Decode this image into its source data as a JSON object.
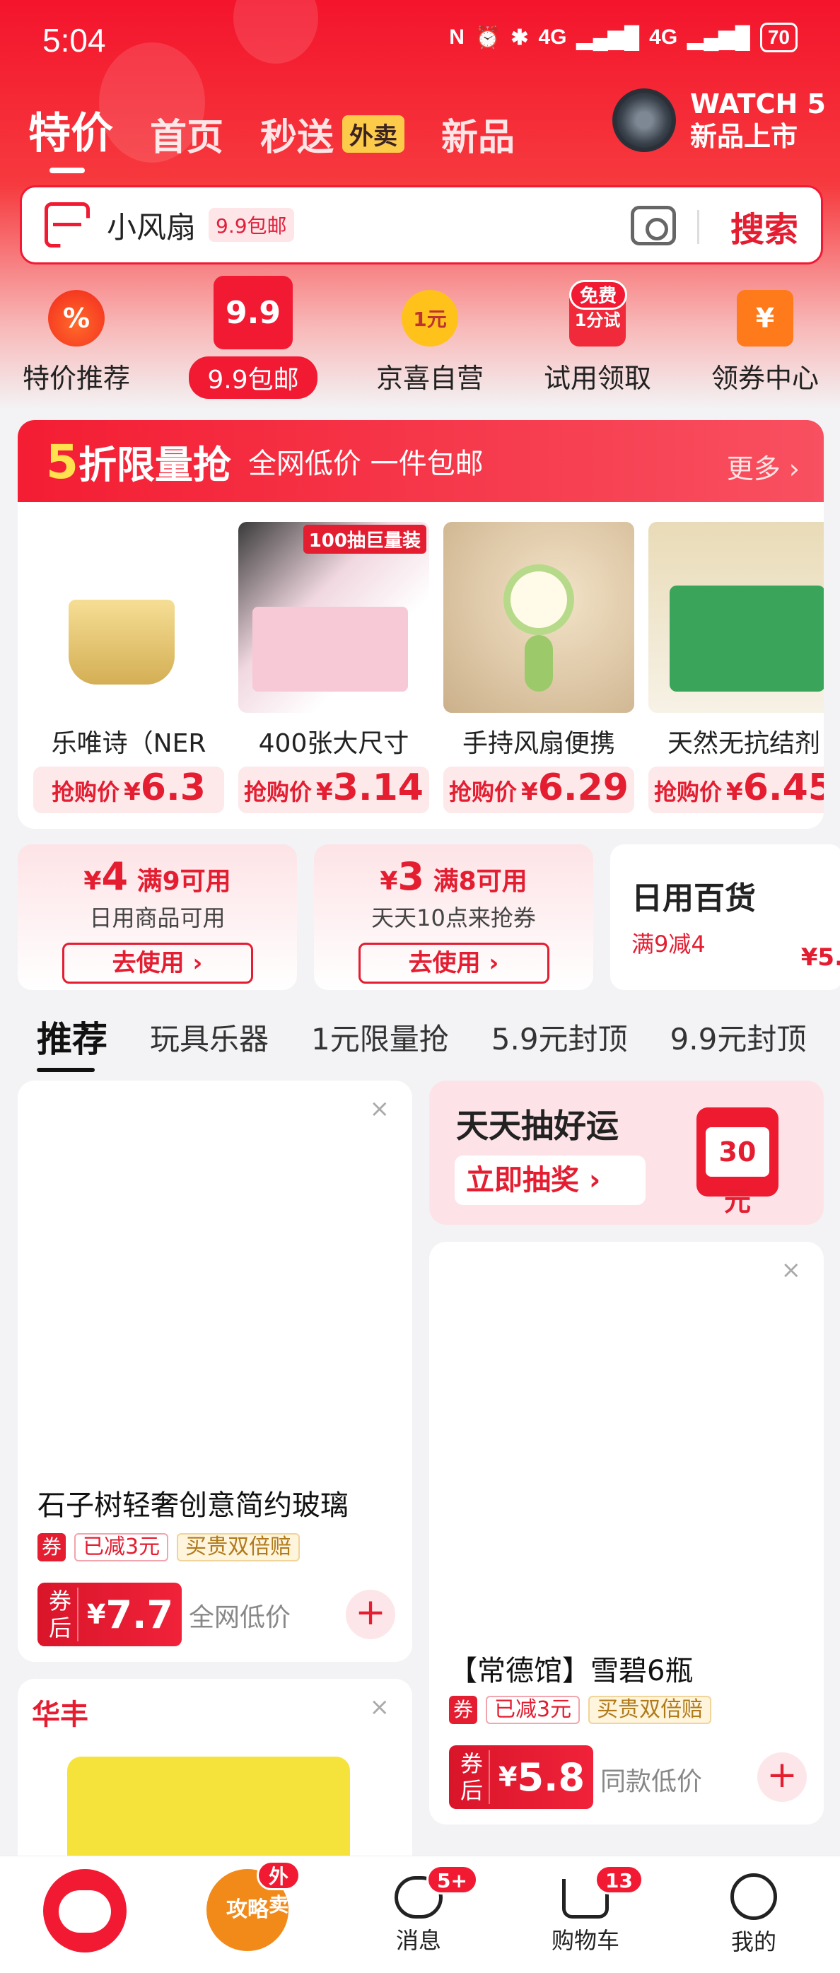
{
  "status_bar": {
    "time": "5:04",
    "network1": "4G",
    "network2": "4G",
    "battery": "70"
  },
  "top_nav": {
    "tabs": [
      {
        "label": "特价",
        "active": true
      },
      {
        "label": "首页"
      },
      {
        "label": "秒送",
        "badge": "外卖"
      },
      {
        "label": "新品"
      }
    ],
    "promo": {
      "line1": "WATCH 5",
      "line2": "新品上市"
    }
  },
  "search": {
    "query": "小风扇",
    "tag": "9.9包邮",
    "button": "搜索"
  },
  "quick_links": [
    {
      "label": "特价推荐",
      "icon": "fire-percent-icon"
    },
    {
      "label": "9.9包邮",
      "icon": "gift-box-icon",
      "icon_text": "9.9"
    },
    {
      "label": "京喜自营",
      "icon": "one-yuan-badge-icon",
      "icon_text": "1元"
    },
    {
      "label": "试用领取",
      "icon": "trial-icon",
      "icon_text": "1分试",
      "badge": "免费"
    },
    {
      "label": "领券中心",
      "icon": "coupon-icon",
      "icon_text": "¥"
    }
  ],
  "flash_sale": {
    "title_num": "5",
    "title": "折限量抢",
    "subtitle": "全网低价 一件包邮",
    "more": "更多 ›",
    "price_label": "抢购价",
    "currency": "¥",
    "products": [
      {
        "name": "乐唯诗（NER",
        "price": "6.3"
      },
      {
        "name": "400张大尺寸",
        "price": "3.14",
        "badge": "100抽巨量装"
      },
      {
        "name": "手持风扇便携",
        "price": "6.29"
      },
      {
        "name": "天然无抗结剂",
        "price": "6.45"
      }
    ]
  },
  "coupons": [
    {
      "currency": "¥",
      "amount": "4",
      "condition": "满9可用",
      "desc": "日用商品可用",
      "button": "去使用 ›"
    },
    {
      "currency": "¥",
      "amount": "3",
      "condition": "满8可用",
      "desc": "天天10点来抢券",
      "button": "去使用 ›"
    },
    {
      "title": "日用百货",
      "sub": "满9减4",
      "price": "¥5."
    }
  ],
  "category_tabs": [
    {
      "label": "推荐",
      "active": true
    },
    {
      "label": "玩具乐器"
    },
    {
      "label": "1元限量抢"
    },
    {
      "label": "5.9元封顶"
    },
    {
      "label": "9.9元封顶"
    }
  ],
  "feed": {
    "left": [
      {
        "title": "石子树轻奢创意简约玻璃",
        "coupon_tag": "券",
        "discount": "已减3元",
        "guarantee": "买贵双倍赔",
        "price_label": "券后",
        "currency": "¥",
        "price": "7.7",
        "note": "全网低价"
      },
      {
        "brand": "华丰"
      }
    ],
    "lottery": {
      "title": "天天抽好运",
      "button": "立即抽奖 ›",
      "coupon": "30元"
    },
    "right": [
      {
        "title": "【常德馆】雪碧6瓶",
        "coupon_tag": "券",
        "discount": "已减3元",
        "guarantee": "买贵双倍赔",
        "price_label": "券后",
        "currency": "¥",
        "price": "5.8",
        "note": "同款低价"
      }
    ]
  },
  "bottom_nav": [
    {
      "label": "",
      "icon": "mascot-home-icon"
    },
    {
      "label": "",
      "icon": "strategy-icon",
      "icon_text": "攻略",
      "badge": "外卖"
    },
    {
      "label": "消息",
      "icon": "message-icon",
      "badge": "5+"
    },
    {
      "label": "购物车",
      "icon": "cart-icon",
      "badge": "13"
    },
    {
      "label": "我的",
      "icon": "profile-icon"
    }
  ],
  "colors": {
    "brand_red": "#f21a33",
    "gold": "#ffe14d"
  }
}
